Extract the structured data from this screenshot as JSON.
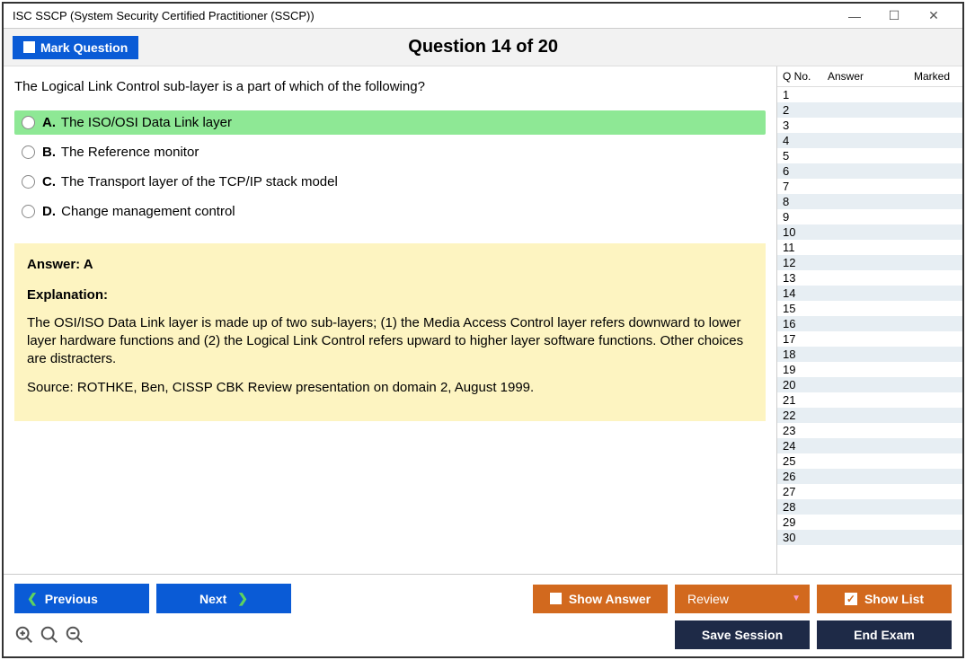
{
  "window": {
    "title": "ISC SSCP (System Security Certified Practitioner (SSCP))"
  },
  "header": {
    "mark_label": "Mark Question",
    "question_title": "Question 14 of 20"
  },
  "question": {
    "text": "The Logical Link Control sub-layer is a part of which of the following?",
    "options": [
      {
        "letter": "A.",
        "text": "The ISO/OSI Data Link layer",
        "correct": true
      },
      {
        "letter": "B.",
        "text": "The Reference monitor",
        "correct": false
      },
      {
        "letter": "C.",
        "text": "The Transport layer of the TCP/IP stack model",
        "correct": false
      },
      {
        "letter": "D.",
        "text": "Change management control",
        "correct": false
      }
    ]
  },
  "answer_box": {
    "answer_label": "Answer: A",
    "explanation_label": "Explanation:",
    "explanation_1": "The OSI/ISO Data Link layer is made up of two sub-layers; (1) the Media Access Control layer refers downward to lower layer hardware functions and (2) the Logical Link Control refers upward to higher layer software functions. Other choices are distracters.",
    "explanation_2": "Source: ROTHKE, Ben, CISSP CBK Review presentation on domain 2, August 1999."
  },
  "side": {
    "col_q": "Q No.",
    "col_a": "Answer",
    "col_m": "Marked",
    "rows": [
      "1",
      "2",
      "3",
      "4",
      "5",
      "6",
      "7",
      "8",
      "9",
      "10",
      "11",
      "12",
      "13",
      "14",
      "15",
      "16",
      "17",
      "18",
      "19",
      "20",
      "21",
      "22",
      "23",
      "24",
      "25",
      "26",
      "27",
      "28",
      "29",
      "30"
    ]
  },
  "footer": {
    "previous": "Previous",
    "next": "Next",
    "show_answer": "Show Answer",
    "review": "Review",
    "show_list": "Show List",
    "save_session": "Save Session",
    "end_exam": "End Exam"
  }
}
